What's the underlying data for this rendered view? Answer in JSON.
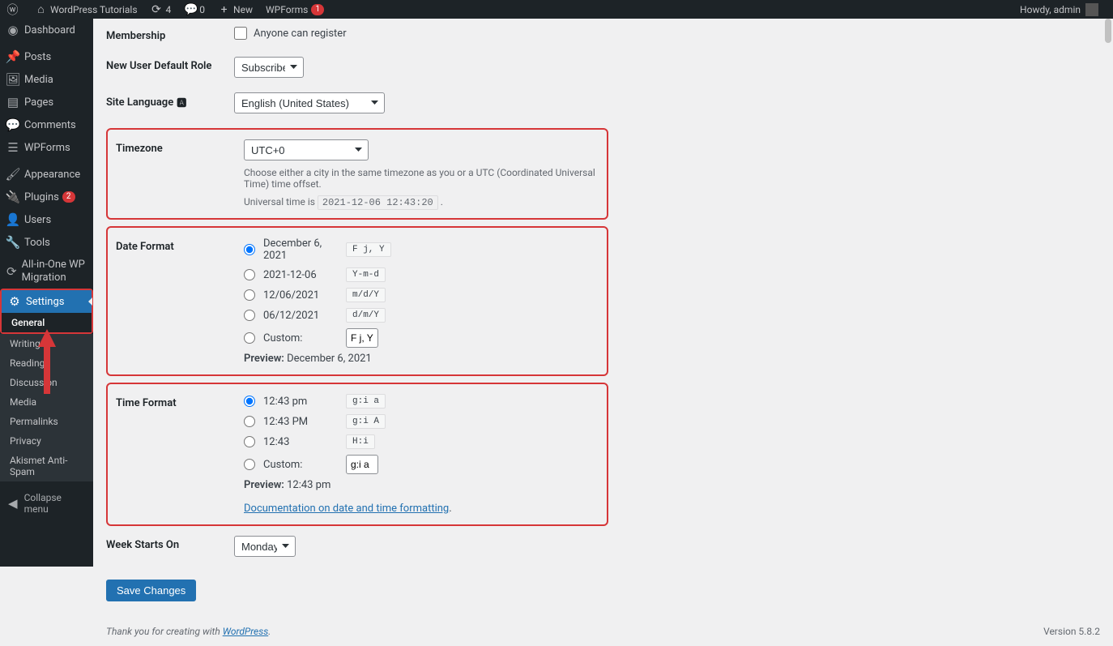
{
  "adminbar": {
    "site_title": "WordPress Tutorials",
    "updates": "4",
    "comments": "0",
    "new_label": "New",
    "wpforms_label": "WPForms",
    "wpforms_badge": "1",
    "howdy": "Howdy, admin"
  },
  "sidebar": {
    "dashboard": "Dashboard",
    "posts": "Posts",
    "media": "Media",
    "pages": "Pages",
    "comments": "Comments",
    "wpforms": "WPForms",
    "appearance": "Appearance",
    "plugins": "Plugins",
    "plugins_badge": "2",
    "users": "Users",
    "tools": "Tools",
    "migration": "All-in-One WP Migration",
    "settings": "Settings",
    "sub": {
      "general": "General",
      "writing": "Writing",
      "reading": "Reading",
      "discussion": "Discussion",
      "media": "Media",
      "permalinks": "Permalinks",
      "privacy": "Privacy",
      "akismet": "Akismet Anti-Spam"
    },
    "collapse": "Collapse menu"
  },
  "fields": {
    "membership_label": "Membership",
    "membership_check": "Anyone can register",
    "default_role_label": "New User Default Role",
    "default_role_value": "Subscriber",
    "site_lang_label": "Site Language",
    "site_lang_value": "English (United States)",
    "timezone_label": "Timezone",
    "timezone_value": "UTC+0",
    "timezone_desc": "Choose either a city in the same timezone as you or a UTC (Coordinated Universal Time) time offset.",
    "universal_time_prefix": "Universal time is ",
    "universal_time_value": "2021-12-06 12:43:20",
    "date_format_label": "Date Format",
    "date_opts": [
      {
        "label": "December 6, 2021",
        "code": "F j, Y",
        "checked": true
      },
      {
        "label": "2021-12-06",
        "code": "Y-m-d",
        "checked": false
      },
      {
        "label": "12/06/2021",
        "code": "m/d/Y",
        "checked": false
      },
      {
        "label": "06/12/2021",
        "code": "d/m/Y",
        "checked": false
      }
    ],
    "date_custom_label": "Custom:",
    "date_custom_value": "F j, Y",
    "date_preview_label": "Preview:",
    "date_preview_value": "December 6, 2021",
    "time_format_label": "Time Format",
    "time_opts": [
      {
        "label": "12:43 pm",
        "code": "g:i a",
        "checked": true
      },
      {
        "label": "12:43 PM",
        "code": "g:i A",
        "checked": false
      },
      {
        "label": "12:43",
        "code": "H:i",
        "checked": false
      }
    ],
    "time_custom_label": "Custom:",
    "time_custom_value": "g:i a",
    "time_preview_label": "Preview:",
    "time_preview_value": "12:43 pm",
    "doc_link": "Documentation on date and time formatting",
    "week_label": "Week Starts On",
    "week_value": "Monday",
    "save_button": "Save Changes"
  },
  "footer": {
    "thanks_prefix": "Thank you for creating with ",
    "wp_link": "WordPress",
    "thanks_suffix": ".",
    "version": "Version 5.8.2"
  }
}
